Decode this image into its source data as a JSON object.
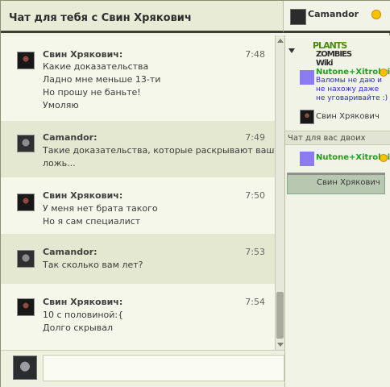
{
  "header": {
    "title": "Чат для тебя с Свин Хрякович",
    "current_user": "Camandor"
  },
  "messages": [
    {
      "name": "Свин Хрякович:",
      "time": "7:48",
      "lines": [
        "Какие доказательства",
        "Ладно мне меньше 13-ти",
        "Но прошу не баньте!",
        "Умоляю"
      ]
    },
    {
      "name": "Camandor:",
      "time": "7:49",
      "lines": [
        "Такие доказательства, которые раскрывают вашу",
        "ложь..."
      ]
    },
    {
      "name": "Свин Хрякович:",
      "time": "7:50",
      "lines": [
        "У меня нет брата такого",
        "Но я сам специалист"
      ]
    },
    {
      "name": "Camandor:",
      "time": "7:53",
      "lines": [
        "Так сколько вам лет?"
      ]
    },
    {
      "name": "Свин Хрякович:",
      "time": "7:54",
      "lines": [
        "10 с половиной:{",
        "Долго скрывал"
      ]
    }
  ],
  "composer": {
    "value": "",
    "placeholder": ""
  },
  "sidebar": {
    "logo_top": "PLANTS",
    "logo_bottom": "ZOMBIES Wiki",
    "public_users": [
      {
        "name": "Nutone+Xitrokris",
        "status": "Валомы не даю и не нахожу даже не уговаривайте :)"
      },
      {
        "name": "Свин Хрякович"
      }
    ],
    "private_section_label": "Чат для вас двоих",
    "private_users": [
      {
        "name": "Nutone+Xitrokris"
      },
      {
        "name": "Свин Хрякович"
      }
    ]
  },
  "colors": {
    "header_bg": "#e8ecd6",
    "alt_message_bg": "#e4e8d0",
    "selected_user_bg": "#b7c7b0",
    "username_green": "#19a51d",
    "status_blue": "#2b2bd8"
  },
  "icons": [
    "smiley-icon",
    "collapse-arrow-icon",
    "scroll-up-icon",
    "scroll-down-icon"
  ]
}
